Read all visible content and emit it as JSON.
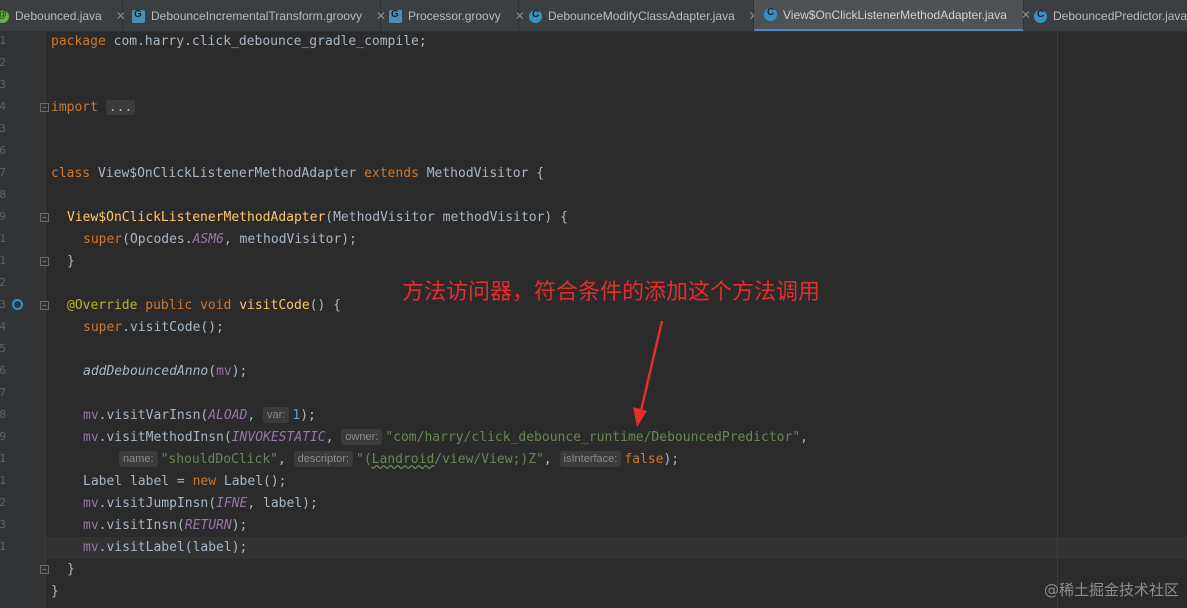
{
  "tabs": [
    {
      "label": "Debounced.java",
      "icon": "annotation-icon"
    },
    {
      "label": "DebounceIncrementalTransform.groovy",
      "icon": "groovy-icon"
    },
    {
      "label": "Processor.groovy",
      "icon": "groovy-icon"
    },
    {
      "label": "DebounceModifyClassAdapter.java",
      "icon": "java-class-icon"
    },
    {
      "label": "View$OnClickListenerMethodAdapter.java",
      "icon": "java-class-icon",
      "active": true
    },
    {
      "label": "DebouncedPredictor.java",
      "icon": "java-class-icon"
    }
  ],
  "line_numbers": [
    "1",
    "2",
    "3",
    "4",
    "3",
    "6",
    "7",
    "8",
    "9",
    "1",
    "1",
    "2",
    "3",
    "4",
    "5",
    "6",
    "7",
    "8",
    "9",
    "1",
    "1",
    "2",
    "3",
    "1"
  ],
  "code": {
    "l1": {
      "kw": "package",
      "pkg": " com.harry.click_debounce_gradle_compile;"
    },
    "l4": {
      "kw": "import",
      "collapsed": "..."
    },
    "l6": {
      "kw1": "class",
      "name": " View$OnClickListenerMethodAdapter ",
      "kw2": "extends",
      "rest": " MethodVisitor {"
    },
    "l8": {
      "ctor": "View$OnClickListenerMethodAdapter",
      "params": "(MethodVisitor methodVisitor) {"
    },
    "l9": {
      "kw": "super",
      "open": "(Opcodes.",
      "const": "ASM6",
      "rest": ", methodVisitor);"
    },
    "l10": {
      "brace": "}"
    },
    "l11": {
      "anno": "@Override",
      "mods": " public void ",
      "fn": "visitCode",
      "rest": "() {"
    },
    "l12": {
      "kw": "super",
      "rest": ".visitCode();"
    },
    "l13": {
      "fn": "addDebouncedAnno",
      "open": "(",
      "var": "mv",
      "close": ");"
    },
    "l14": {
      "var": "mv",
      "call": ".visitVarInsn(",
      "const": "ALOAD",
      "sep": ", ",
      "hint": "var:",
      "num": "1",
      "close": ");"
    },
    "l15": {
      "var": "mv",
      "call": ".visitMethodInsn(",
      "const": "INVOKESTATIC",
      "sep": ", ",
      "hint": "owner:",
      "str": "\"com/harry/click_debounce_runtime/DebouncedPredictor\"",
      "tail": ","
    },
    "l16": {
      "hint1": "name:",
      "str1": "\"shouldDoClick\"",
      "sep": ", ",
      "hint2": "descriptor:",
      "str2a": "\"(",
      "str2b": "Landroid",
      "str2c": "/view/View;)Z\"",
      "hint3": "isInterface:",
      "kw": "false",
      "close": ");"
    },
    "l17": {
      "text1": "Label label = ",
      "kw": "new",
      "text2": " Label();"
    },
    "l18": {
      "var": "mv",
      "call": ".visitJumpInsn(",
      "const": "IFNE",
      "rest": ", label);"
    },
    "l19": {
      "var": "mv",
      "call": ".visitInsn(",
      "const": "RETURN",
      "close": ");"
    },
    "l20": {
      "var": "mv",
      "rest": ".visitLabel(label);"
    },
    "l21": {
      "brace": "}"
    },
    "l22": {
      "brace": "}"
    }
  },
  "annotation_text": "方法访问器，符合条件的添加这个方法调用",
  "watermark": "@稀土掘金技术社区",
  "colors": {
    "annotation": "#e32e2e",
    "background": "#2b2b2b",
    "keyword": "#cc7832",
    "string": "#6a8759"
  }
}
